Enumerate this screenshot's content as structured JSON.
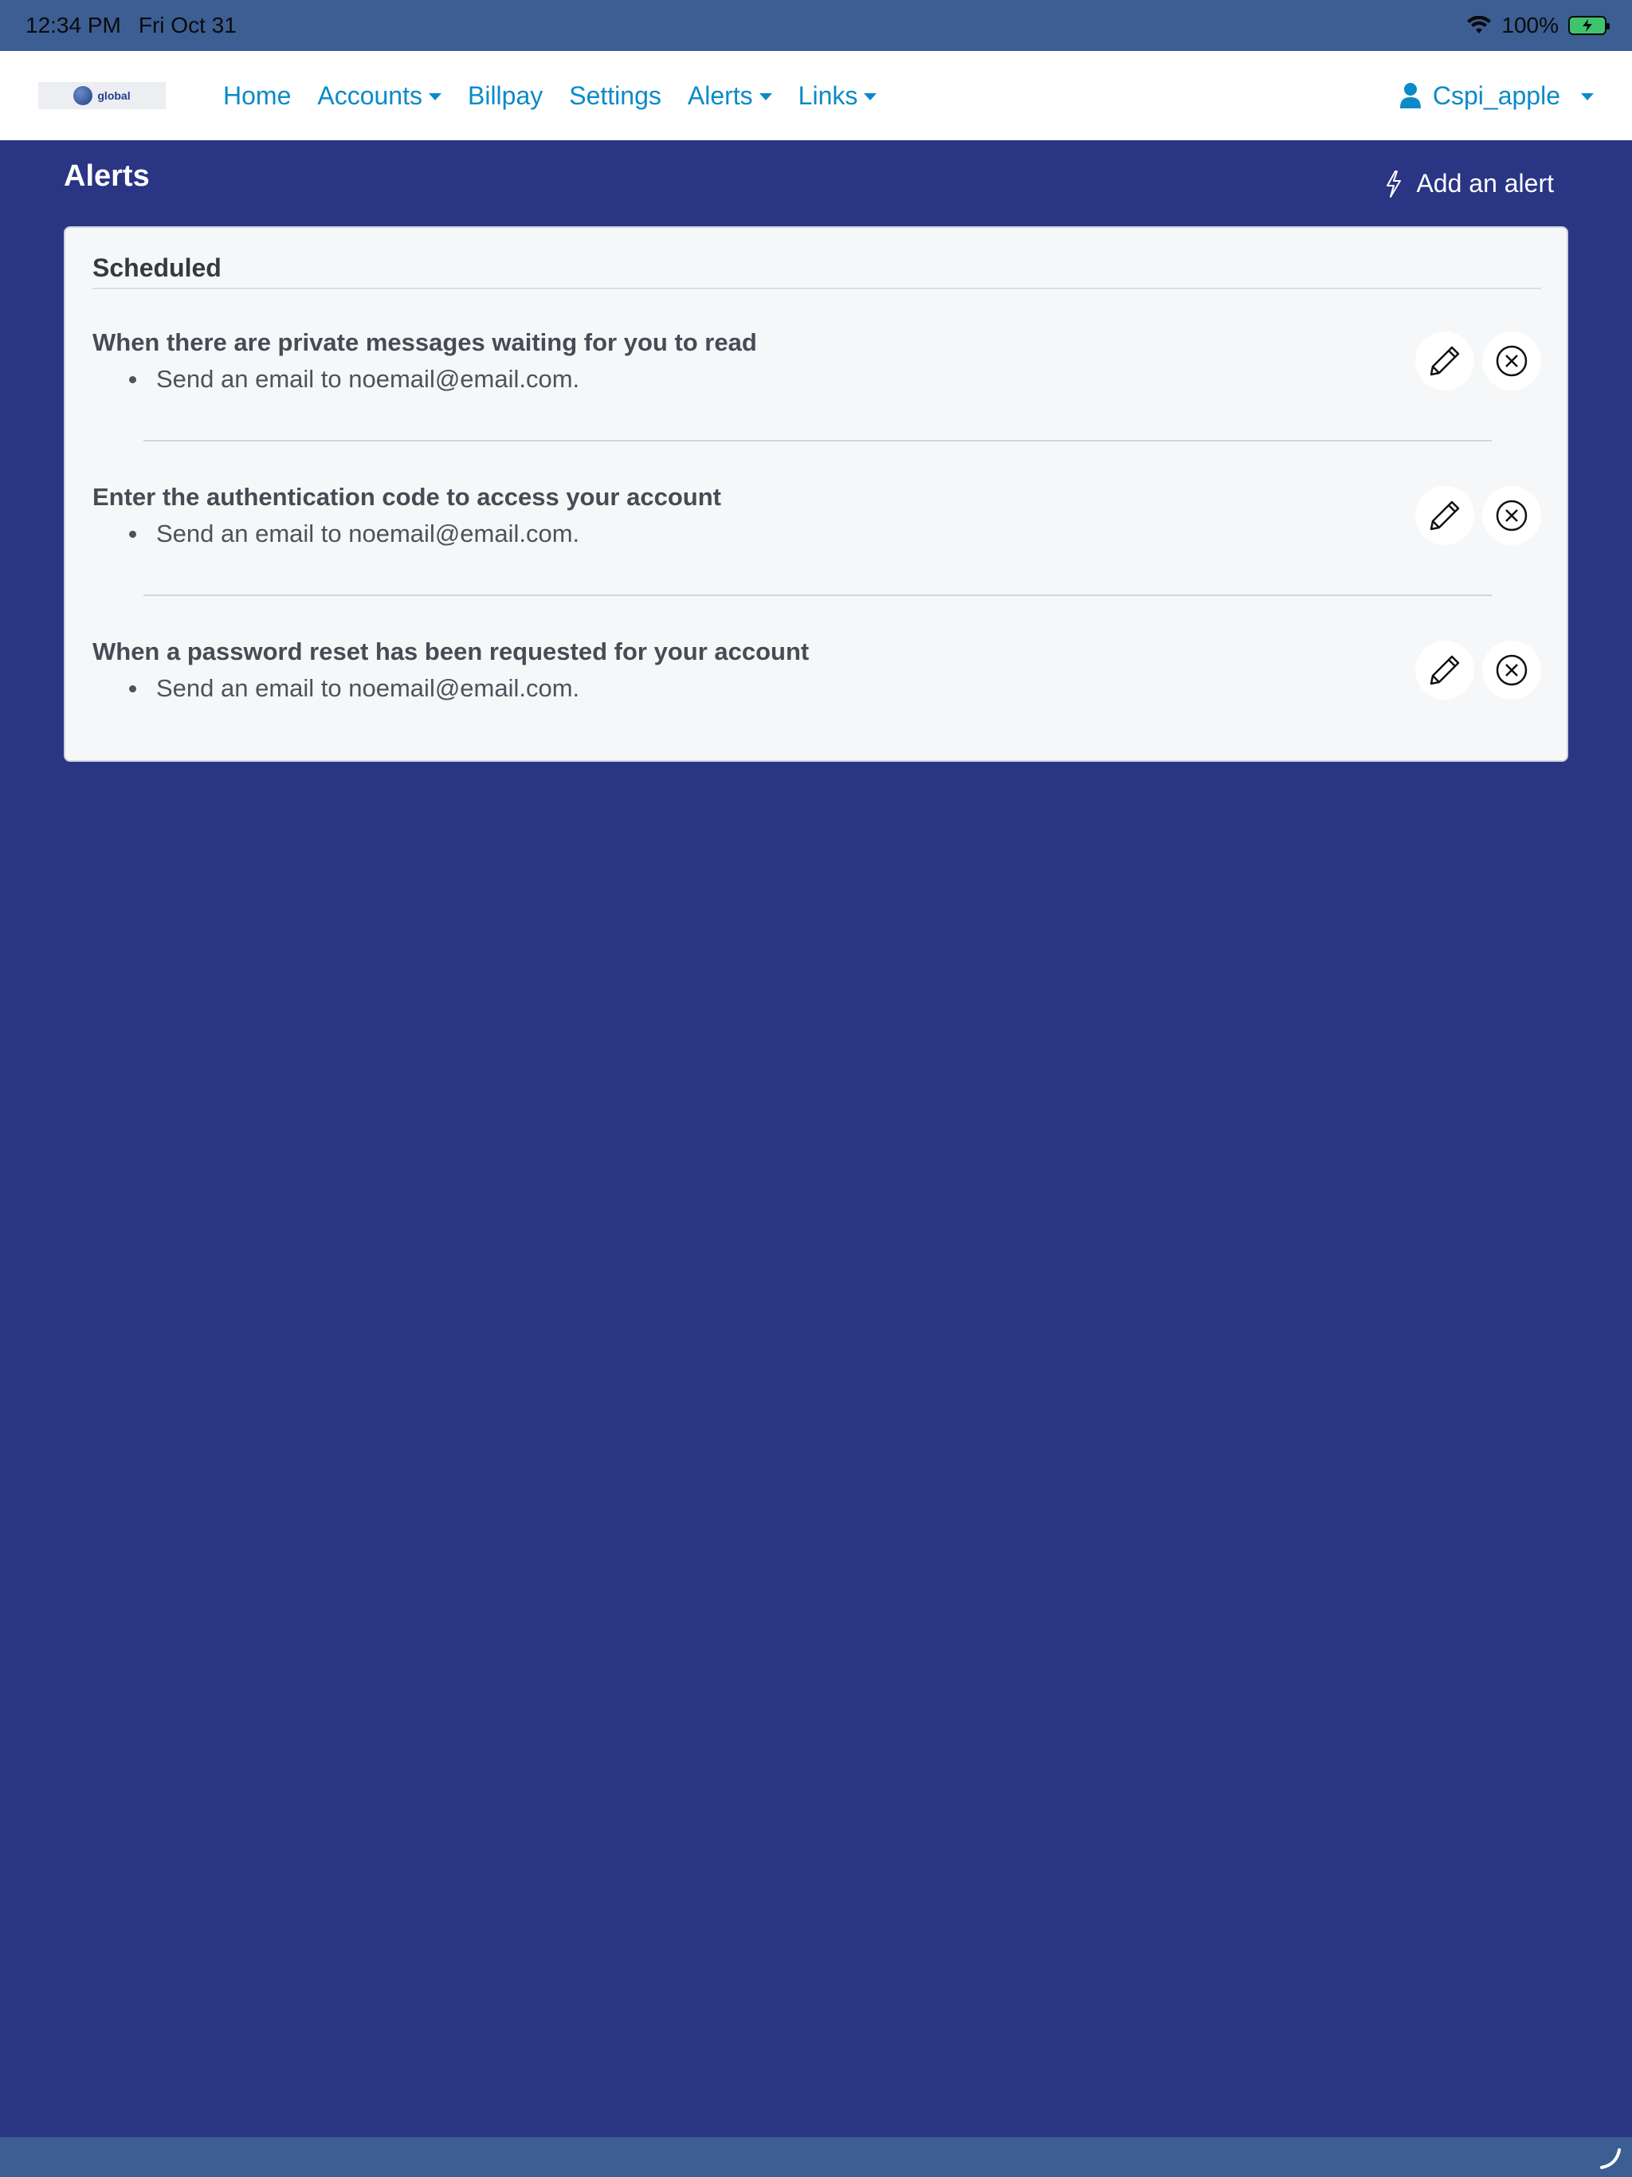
{
  "status_bar": {
    "time": "12:34 PM",
    "date": "Fri Oct 31",
    "battery": "100%"
  },
  "navbar": {
    "logo_text": "global",
    "links": [
      {
        "label": "Home",
        "dropdown": false
      },
      {
        "label": "Accounts",
        "dropdown": true
      },
      {
        "label": "Billpay",
        "dropdown": false
      },
      {
        "label": "Settings",
        "dropdown": false
      },
      {
        "label": "Alerts",
        "dropdown": true
      },
      {
        "label": "Links",
        "dropdown": true
      }
    ],
    "user": "Cspi_apple"
  },
  "page": {
    "title": "Alerts",
    "add_alert_label": "Add an alert"
  },
  "card": {
    "header": "Scheduled",
    "alerts": [
      {
        "title": "When there are private messages waiting for you to read",
        "action": "Send an email to noemail@email.com."
      },
      {
        "title": "Enter the authentication code to access your account",
        "action": "Send an email to noemail@email.com."
      },
      {
        "title": "When a password reset has been requested for your account",
        "action": "Send an email to noemail@email.com."
      }
    ]
  },
  "icons": {
    "edit": "pencil-icon",
    "delete": "close-circle-icon",
    "add_alert": "lightning-icon",
    "user": "user-icon"
  },
  "colors": {
    "page_bg": "#2a3584",
    "status_bar": "#3c5e93",
    "nav_link": "#0b8ac9",
    "card_bg": "#f6f7f9"
  }
}
